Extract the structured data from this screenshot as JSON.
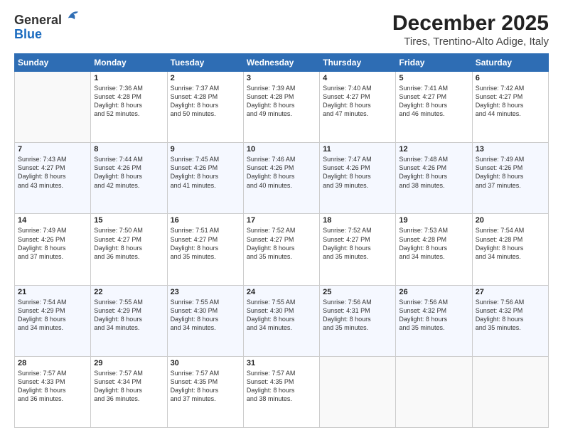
{
  "logo": {
    "line1": "General",
    "line2": "Blue"
  },
  "title": "December 2025",
  "subtitle": "Tires, Trentino-Alto Adige, Italy",
  "days_header": [
    "Sunday",
    "Monday",
    "Tuesday",
    "Wednesday",
    "Thursday",
    "Friday",
    "Saturday"
  ],
  "weeks": [
    [
      {
        "day": "",
        "content": ""
      },
      {
        "day": "1",
        "content": "Sunrise: 7:36 AM\nSunset: 4:28 PM\nDaylight: 8 hours\nand 52 minutes."
      },
      {
        "day": "2",
        "content": "Sunrise: 7:37 AM\nSunset: 4:28 PM\nDaylight: 8 hours\nand 50 minutes."
      },
      {
        "day": "3",
        "content": "Sunrise: 7:39 AM\nSunset: 4:28 PM\nDaylight: 8 hours\nand 49 minutes."
      },
      {
        "day": "4",
        "content": "Sunrise: 7:40 AM\nSunset: 4:27 PM\nDaylight: 8 hours\nand 47 minutes."
      },
      {
        "day": "5",
        "content": "Sunrise: 7:41 AM\nSunset: 4:27 PM\nDaylight: 8 hours\nand 46 minutes."
      },
      {
        "day": "6",
        "content": "Sunrise: 7:42 AM\nSunset: 4:27 PM\nDaylight: 8 hours\nand 44 minutes."
      }
    ],
    [
      {
        "day": "7",
        "content": "Sunrise: 7:43 AM\nSunset: 4:27 PM\nDaylight: 8 hours\nand 43 minutes."
      },
      {
        "day": "8",
        "content": "Sunrise: 7:44 AM\nSunset: 4:26 PM\nDaylight: 8 hours\nand 42 minutes."
      },
      {
        "day": "9",
        "content": "Sunrise: 7:45 AM\nSunset: 4:26 PM\nDaylight: 8 hours\nand 41 minutes."
      },
      {
        "day": "10",
        "content": "Sunrise: 7:46 AM\nSunset: 4:26 PM\nDaylight: 8 hours\nand 40 minutes."
      },
      {
        "day": "11",
        "content": "Sunrise: 7:47 AM\nSunset: 4:26 PM\nDaylight: 8 hours\nand 39 minutes."
      },
      {
        "day": "12",
        "content": "Sunrise: 7:48 AM\nSunset: 4:26 PM\nDaylight: 8 hours\nand 38 minutes."
      },
      {
        "day": "13",
        "content": "Sunrise: 7:49 AM\nSunset: 4:26 PM\nDaylight: 8 hours\nand 37 minutes."
      }
    ],
    [
      {
        "day": "14",
        "content": "Sunrise: 7:49 AM\nSunset: 4:26 PM\nDaylight: 8 hours\nand 37 minutes."
      },
      {
        "day": "15",
        "content": "Sunrise: 7:50 AM\nSunset: 4:27 PM\nDaylight: 8 hours\nand 36 minutes."
      },
      {
        "day": "16",
        "content": "Sunrise: 7:51 AM\nSunset: 4:27 PM\nDaylight: 8 hours\nand 35 minutes."
      },
      {
        "day": "17",
        "content": "Sunrise: 7:52 AM\nSunset: 4:27 PM\nDaylight: 8 hours\nand 35 minutes."
      },
      {
        "day": "18",
        "content": "Sunrise: 7:52 AM\nSunset: 4:27 PM\nDaylight: 8 hours\nand 35 minutes."
      },
      {
        "day": "19",
        "content": "Sunrise: 7:53 AM\nSunset: 4:28 PM\nDaylight: 8 hours\nand 34 minutes."
      },
      {
        "day": "20",
        "content": "Sunrise: 7:54 AM\nSunset: 4:28 PM\nDaylight: 8 hours\nand 34 minutes."
      }
    ],
    [
      {
        "day": "21",
        "content": "Sunrise: 7:54 AM\nSunset: 4:29 PM\nDaylight: 8 hours\nand 34 minutes."
      },
      {
        "day": "22",
        "content": "Sunrise: 7:55 AM\nSunset: 4:29 PM\nDaylight: 8 hours\nand 34 minutes."
      },
      {
        "day": "23",
        "content": "Sunrise: 7:55 AM\nSunset: 4:30 PM\nDaylight: 8 hours\nand 34 minutes."
      },
      {
        "day": "24",
        "content": "Sunrise: 7:55 AM\nSunset: 4:30 PM\nDaylight: 8 hours\nand 34 minutes."
      },
      {
        "day": "25",
        "content": "Sunrise: 7:56 AM\nSunset: 4:31 PM\nDaylight: 8 hours\nand 35 minutes."
      },
      {
        "day": "26",
        "content": "Sunrise: 7:56 AM\nSunset: 4:32 PM\nDaylight: 8 hours\nand 35 minutes."
      },
      {
        "day": "27",
        "content": "Sunrise: 7:56 AM\nSunset: 4:32 PM\nDaylight: 8 hours\nand 35 minutes."
      }
    ],
    [
      {
        "day": "28",
        "content": "Sunrise: 7:57 AM\nSunset: 4:33 PM\nDaylight: 8 hours\nand 36 minutes."
      },
      {
        "day": "29",
        "content": "Sunrise: 7:57 AM\nSunset: 4:34 PM\nDaylight: 8 hours\nand 36 minutes."
      },
      {
        "day": "30",
        "content": "Sunrise: 7:57 AM\nSunset: 4:35 PM\nDaylight: 8 hours\nand 37 minutes."
      },
      {
        "day": "31",
        "content": "Sunrise: 7:57 AM\nSunset: 4:35 PM\nDaylight: 8 hours\nand 38 minutes."
      },
      {
        "day": "",
        "content": ""
      },
      {
        "day": "",
        "content": ""
      },
      {
        "day": "",
        "content": ""
      }
    ]
  ]
}
